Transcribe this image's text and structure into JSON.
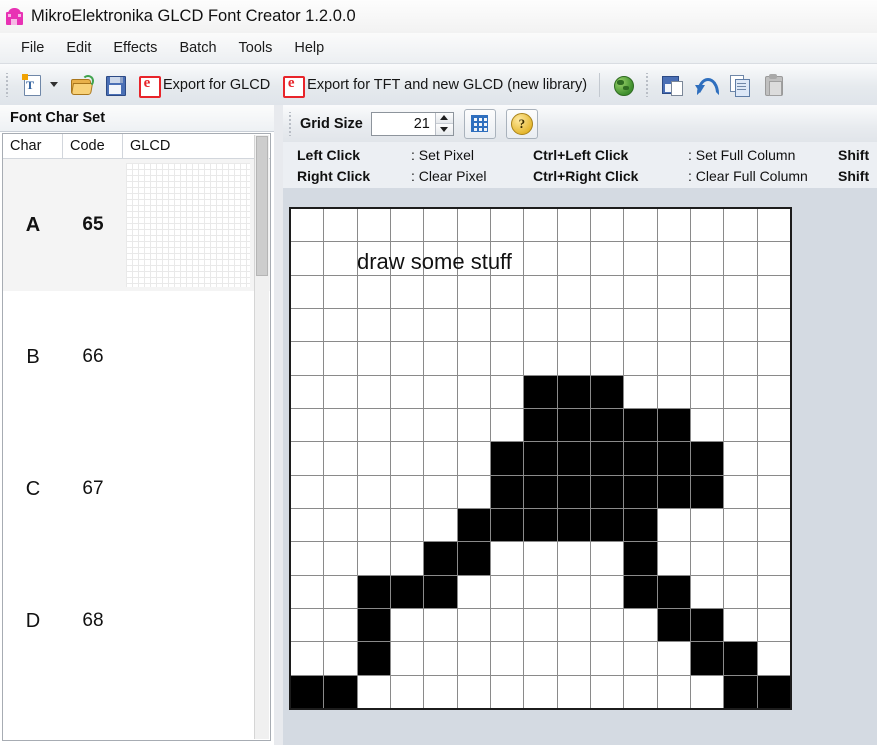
{
  "window": {
    "title": "MikroElektronika GLCD Font Creator 1.2.0.0",
    "icon": "app-icon"
  },
  "menubar": {
    "items": [
      {
        "label": "File"
      },
      {
        "label": "Edit"
      },
      {
        "label": "Effects"
      },
      {
        "label": "Batch"
      },
      {
        "label": "Tools"
      },
      {
        "label": "Help"
      }
    ]
  },
  "toolbar": {
    "new_font_icon": "new-font-icon",
    "open_icon": "open-folder-icon",
    "save_icon": "save-floppy-icon",
    "export_glcd_label": "Export for GLCD",
    "export_glcd_icon": "export-e-icon",
    "export_tft_label": "Export for TFT and new GLCD (new library)",
    "export_tft_icon": "export-e-icon",
    "globe_icon": "globe-icon",
    "save_as_icon": "save-as-icon",
    "undo_icon": "undo-icon",
    "copy_icon": "copy-icon",
    "paste_icon": "paste-icon"
  },
  "left_panel": {
    "header": "Font Char Set",
    "columns": [
      "Char",
      "Code",
      "GLCD"
    ],
    "rows": [
      {
        "char": "A",
        "code": "65",
        "selected": true,
        "preview": "minigrid"
      },
      {
        "char": "B",
        "code": "66",
        "selected": false,
        "preview": ""
      },
      {
        "char": "C",
        "code": "67",
        "selected": false,
        "preview": ""
      },
      {
        "char": "D",
        "code": "68",
        "selected": false,
        "preview": ""
      }
    ]
  },
  "grid_toolbar": {
    "grid_size_label": "Grid Size",
    "grid_size_value": "21",
    "grid_size_placeholder": "21",
    "toggle_grid_icon": "grid-toggle-icon",
    "help_icon": "help-icon",
    "help_glyph": "?"
  },
  "legend": {
    "rows": [
      [
        {
          "text": "Left Click",
          "bold": true
        },
        {
          "text": ": Set Pixel",
          "bold": false
        },
        {
          "text": "Ctrl+Left Click",
          "bold": true
        },
        {
          "text": ": Set Full Column",
          "bold": false
        },
        {
          "text": "Shift",
          "bold": true
        }
      ],
      [
        {
          "text": "Right Click",
          "bold": true
        },
        {
          "text": ": Clear Pixel",
          "bold": false
        },
        {
          "text": "Ctrl+Right Click",
          "bold": true
        },
        {
          "text": ": Clear Full Column",
          "bold": false
        },
        {
          "text": "Shift",
          "bold": true
        }
      ]
    ],
    "l0r0": "Left Click",
    "l0r1": ": Set Pixel",
    "l0r2": "Ctrl+Left Click",
    "l0r3": ": Set Full Column",
    "l0r4": "Shift",
    "l1r0": "Right Click",
    "l1r1": ": Clear Pixel",
    "l1r2": "Ctrl+Right Click",
    "l1r3": ": Clear Full Column",
    "l1r4": "Shift"
  },
  "canvas": {
    "annotation": "draw some stuff",
    "cols": 15,
    "rows": 15,
    "on_color": "#000000",
    "off_color": "#ffffff",
    "pixels": [
      [
        0,
        0,
        0,
        0,
        0,
        0,
        0,
        0,
        0,
        0,
        0,
        0,
        0,
        0,
        0
      ],
      [
        0,
        0,
        0,
        0,
        0,
        0,
        0,
        0,
        0,
        0,
        0,
        0,
        0,
        0,
        0
      ],
      [
        0,
        0,
        0,
        0,
        0,
        0,
        0,
        0,
        0,
        0,
        0,
        0,
        0,
        0,
        0
      ],
      [
        0,
        0,
        0,
        0,
        0,
        0,
        0,
        0,
        0,
        0,
        0,
        0,
        0,
        0,
        0
      ],
      [
        0,
        0,
        0,
        0,
        0,
        0,
        0,
        0,
        0,
        0,
        0,
        0,
        0,
        0,
        0
      ],
      [
        0,
        0,
        0,
        0,
        0,
        0,
        0,
        1,
        1,
        1,
        0,
        0,
        0,
        0,
        0
      ],
      [
        0,
        0,
        0,
        0,
        0,
        0,
        0,
        1,
        1,
        1,
        1,
        1,
        0,
        0,
        0
      ],
      [
        0,
        0,
        0,
        0,
        0,
        0,
        1,
        1,
        1,
        1,
        1,
        1,
        1,
        0,
        0
      ],
      [
        0,
        0,
        0,
        0,
        0,
        0,
        1,
        1,
        1,
        1,
        1,
        1,
        1,
        0,
        0
      ],
      [
        0,
        0,
        0,
        0,
        0,
        1,
        1,
        1,
        1,
        1,
        1,
        0,
        0,
        0,
        0
      ],
      [
        0,
        0,
        0,
        0,
        1,
        1,
        0,
        0,
        0,
        0,
        1,
        0,
        0,
        0,
        0
      ],
      [
        0,
        0,
        1,
        1,
        1,
        0,
        0,
        0,
        0,
        0,
        1,
        1,
        0,
        0,
        0
      ],
      [
        0,
        0,
        1,
        0,
        0,
        0,
        0,
        0,
        0,
        0,
        0,
        1,
        1,
        0,
        0
      ],
      [
        0,
        0,
        1,
        0,
        0,
        0,
        0,
        0,
        0,
        0,
        0,
        0,
        1,
        1,
        0
      ],
      [
        0,
        1,
        0,
        0,
        0,
        0,
        0,
        0,
        0,
        0,
        0,
        0,
        0,
        1,
        1
      ]
    ],
    "last_row": [
      1,
      1,
      0,
      0,
      0,
      0,
      0,
      0,
      0,
      0,
      0,
      0,
      0,
      1,
      1
    ]
  },
  "colors": {
    "accent": "#2f6fbe",
    "export_red": "#e8242a",
    "app_icon": "#e832b4",
    "panel_bg": "#d4dae2"
  }
}
